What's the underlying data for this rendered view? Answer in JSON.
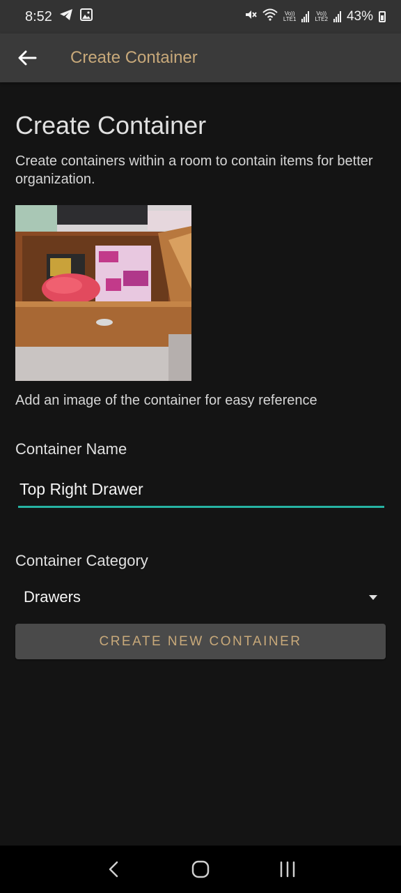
{
  "status_bar": {
    "time": "8:52",
    "battery": "43%",
    "sim1_label_top": "Vo))",
    "sim1_label_bottom": "LTE1",
    "sim2_label_top": "Vo))",
    "sim2_label_bottom": "LTE2",
    "icons": [
      "telegram-icon",
      "gallery-icon",
      "mute-icon",
      "wifi-icon",
      "signal-icon",
      "battery-icon"
    ]
  },
  "app_bar": {
    "title": "Create Container",
    "back_icon": "back-arrow-icon"
  },
  "main": {
    "heading": "Create Container",
    "description": "Create containers within a room to contain items for better organization.",
    "photo_hint": "Add an image of the container for easy reference",
    "name_label": "Container Name",
    "name_value": "Top Right Drawer",
    "category_label": "Container Category",
    "category_value": "Drawers",
    "create_button": "CREATE NEW CONTAINER"
  },
  "nav_bar": {
    "icons": [
      "back-icon",
      "home-icon",
      "recents-icon"
    ]
  },
  "colors": {
    "accent": "#26b3a3",
    "title_gold": "#c8a97a",
    "background": "#141414",
    "app_bar": "#3a3a3a",
    "button": "#4a4a4a"
  }
}
